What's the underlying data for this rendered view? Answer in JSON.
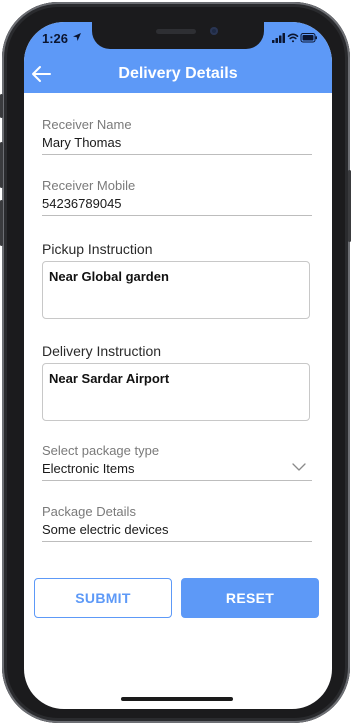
{
  "status_bar": {
    "time": "1:26",
    "icons": [
      "location-arrow-icon",
      "signal-icon",
      "wifi-icon",
      "battery-icon"
    ]
  },
  "header": {
    "title": "Delivery Details",
    "back_icon": "back-arrow-icon",
    "color": "#5d99f7"
  },
  "form": {
    "receiver_name": {
      "label": "Receiver Name",
      "value": "Mary Thomas"
    },
    "receiver_mobile": {
      "label": "Receiver Mobile",
      "value": "54236789045"
    },
    "pickup_instruction": {
      "label": "Pickup Instruction",
      "value": "Near Global garden"
    },
    "delivery_instruction": {
      "label": "Delivery Instruction",
      "value": "Near Sardar Airport"
    },
    "package_type": {
      "label": "Select package type",
      "value": "Electronic Items",
      "icon": "chevron-down-icon"
    },
    "package_details": {
      "label": "Package Details",
      "value": "Some electric devices"
    }
  },
  "buttons": {
    "submit_label": "SUBMIT",
    "reset_label": "RESET"
  },
  "colors": {
    "accent": "#5d99f7",
    "text": "#1a1a1a",
    "label": "#7a7a7a",
    "divider": "#bdbdbd"
  }
}
